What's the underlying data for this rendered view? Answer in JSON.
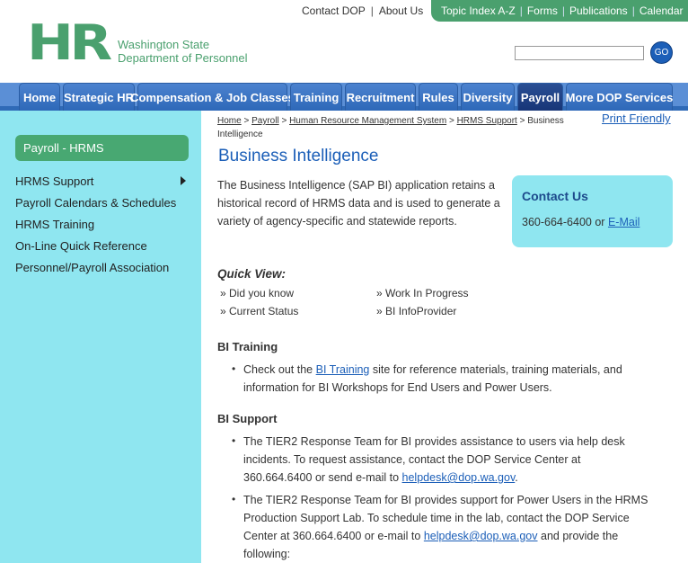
{
  "header": {
    "logo_text": "HR",
    "org_line1": "Washington State",
    "org_line2": "Department of Personnel",
    "top_links": [
      "Contact DOP",
      "About Us"
    ],
    "green_links": [
      "Topic Index A-Z",
      "Forms",
      "Publications",
      "Calendar"
    ],
    "search_placeholder": "",
    "go_label": "GO"
  },
  "nav": {
    "tabs": [
      "Home",
      "Strategic HR",
      "Compensation & Job Classes",
      "Training",
      "Recruitment",
      "Rules",
      "Diversity",
      "Payroll",
      "More DOP Services"
    ],
    "active": "Payroll"
  },
  "sidebar": {
    "heading": "Payroll - HRMS",
    "items": [
      "HRMS Support",
      "Payroll Calendars & Schedules",
      "HRMS Training",
      "On-Line Quick Reference",
      "Personnel/Payroll Association"
    ]
  },
  "breadcrumb": {
    "links": [
      "Home",
      "Payroll",
      "Human Resource Management System",
      "HRMS Support"
    ],
    "separator": ">",
    "current": "Business Intelligence"
  },
  "print_label": "Print Friendly",
  "page_title": "Business Intelligence",
  "intro": "The Business Intelligence (SAP BI) application retains a historical record of HRMS data and is used to generate a variety of agency-specific and statewide reports.",
  "contact": {
    "title": "Contact Us",
    "phone": "360-664-6400",
    "or": "or",
    "email_label": "E-Mail"
  },
  "quick_view": {
    "title": "Quick View:",
    "items": [
      "Did you know",
      "Work In Progress",
      "Current Status",
      "BI InfoProvider"
    ]
  },
  "bi_training": {
    "title": "BI Training",
    "text_before": "Check out the",
    "link": "BI Training",
    "text_after": "site for reference materials, training materials, and information for BI Workshops for End Users and Power Users."
  },
  "bi_support": {
    "title": "BI Support",
    "item1_text": "The TIER2 Response Team for BI provides assistance to users via help desk incidents. To request assistance, contact the DOP Service Center at 360.664.6400 or send e-mail to",
    "item1_link": "helpdesk@dop.wa.gov",
    "item1_end": ".",
    "item2_text": "The TIER2 Response Team for BI provides support for Power Users in the HRMS Production Support Lab. To schedule time in the lab, contact the DOP Service Center at 360.664.6400 or e-mail to",
    "item2_link": "helpdesk@dop.wa.gov",
    "item2_end": "and provide the following:"
  }
}
